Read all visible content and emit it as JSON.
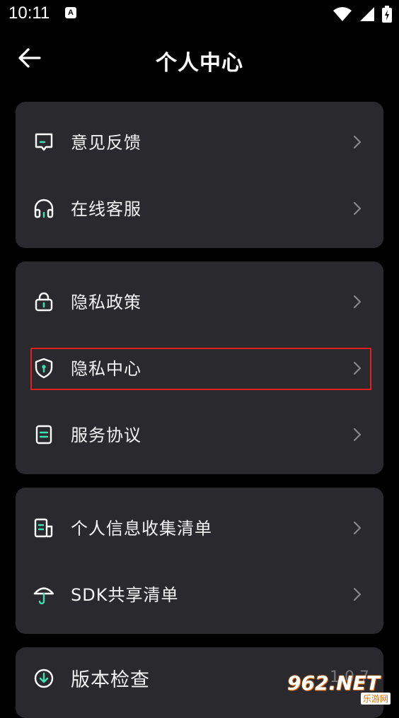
{
  "status_bar": {
    "time": "10:11",
    "notif_glyph": "A"
  },
  "header": {
    "title": "个人中心"
  },
  "cards": [
    {
      "items": [
        {
          "label": "意见反馈",
          "icon": "feedback-icon"
        },
        {
          "label": "在线客服",
          "icon": "headset-icon"
        }
      ]
    },
    {
      "items": [
        {
          "label": "隐私政策",
          "icon": "lock-icon"
        },
        {
          "label": "隐私中心",
          "icon": "shield-keyhole-icon"
        },
        {
          "label": "服务协议",
          "icon": "document-icon"
        }
      ]
    },
    {
      "items": [
        {
          "label": "个人信息收集清单",
          "icon": "info-list-icon"
        },
        {
          "label": "SDK共享清单",
          "icon": "umbrella-icon"
        }
      ]
    },
    {
      "items": [
        {
          "label": "版本检查",
          "icon": "download-circle-icon",
          "value": "1.0.7"
        }
      ]
    }
  ],
  "watermark": {
    "number": "962.NET",
    "site": "乐游网"
  },
  "colors": {
    "accent": "#3fe0b0",
    "card_bg": "#2a2a2e",
    "highlight": "#e02020"
  }
}
